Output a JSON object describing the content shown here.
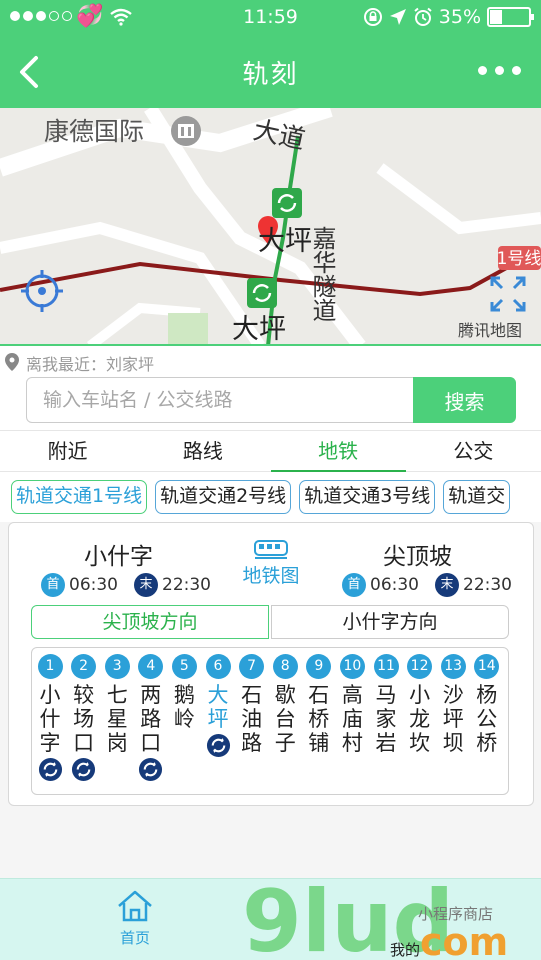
{
  "status_bar": {
    "time": "11:59",
    "battery": "35%",
    "battery_level": 0.35
  },
  "nav": {
    "title": "轨刻"
  },
  "map": {
    "labels": {
      "building": "康德国际",
      "road": "大道",
      "station1": "大坪",
      "station2": "大坪",
      "street": "嘉华隧道",
      "line_tag": "1号线",
      "provider": "腾讯地图"
    }
  },
  "location": {
    "text": "离我最近：刘家坪"
  },
  "search": {
    "placeholder": "输入车站名 / 公交线路",
    "button": "搜索"
  },
  "tabs": [
    {
      "label": "附近"
    },
    {
      "label": "路线"
    },
    {
      "label": "地铁"
    },
    {
      "label": "公交"
    }
  ],
  "lines": [
    {
      "label": "轨道交通1号线"
    },
    {
      "label": "轨道交通2号线"
    },
    {
      "label": "轨道交通3号线"
    },
    {
      "label": "轨道交"
    }
  ],
  "card": {
    "start": {
      "name": "小什字",
      "first_badge": "首",
      "first_time": "06:30",
      "last_badge": "末",
      "last_time": "22:30"
    },
    "end": {
      "name": "尖顶坡",
      "first_badge": "首",
      "first_time": "06:30",
      "last_badge": "末",
      "last_time": "22:30"
    },
    "metro_map": "地铁图",
    "directions": [
      {
        "label": "尖顶坡方向"
      },
      {
        "label": "小什字方向"
      }
    ],
    "stations": [
      {
        "num": "1",
        "name": "小什字",
        "transfer": true
      },
      {
        "num": "2",
        "name": "较场口",
        "transfer": true
      },
      {
        "num": "3",
        "name": "七星岗",
        "transfer": false
      },
      {
        "num": "4",
        "name": "两路口",
        "transfer": true
      },
      {
        "num": "5",
        "name": "鹅岭",
        "transfer": false
      },
      {
        "num": "6",
        "name": "大坪",
        "transfer": true
      },
      {
        "num": "7",
        "name": "石油路",
        "transfer": false
      },
      {
        "num": "8",
        "name": "歇台子",
        "transfer": false
      },
      {
        "num": "9",
        "name": "石桥铺",
        "transfer": false
      },
      {
        "num": "10",
        "name": "高庙村",
        "transfer": false
      },
      {
        "num": "11",
        "name": "马家岩",
        "transfer": false
      },
      {
        "num": "12",
        "name": "小龙坎",
        "transfer": false
      },
      {
        "num": "13",
        "name": "沙坪坝",
        "transfer": false
      },
      {
        "num": "14",
        "name": "杨公桥",
        "transfer": false
      }
    ]
  },
  "bottom": {
    "home": "首页",
    "mine": "我的",
    "watermark": "9lud",
    "watermark_sub": "小程序商店",
    "watermark_com": "com"
  },
  "colors": {
    "brand_green": "#4cd07a",
    "accent_blue": "#2ba0d8",
    "dark_blue": "#163a7a"
  }
}
